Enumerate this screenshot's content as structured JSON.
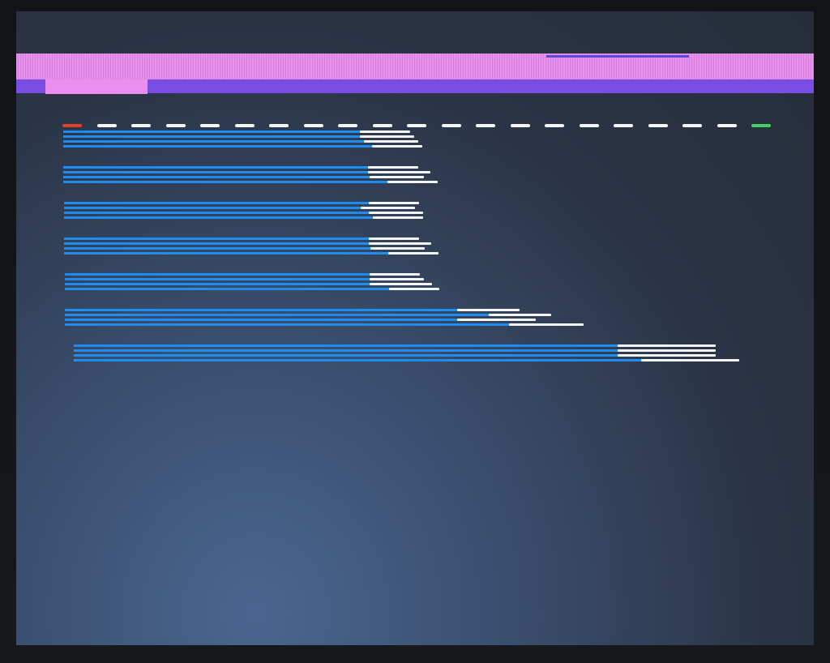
{
  "display": {
    "accent_color": "#e891ea",
    "secondary_color": "#7a4de4",
    "bar_color": "#1f8cf0",
    "tip_color": "#f3f5f7"
  },
  "dash_row": {
    "dash_count": 19,
    "left_marker_color": "#e0402a",
    "right_marker_color": "#3ed15b"
  },
  "groups": [
    {
      "lines": [
        {
          "blue": 0.38,
          "white": 0.055
        },
        {
          "blue": 0.38,
          "white": 0.06
        },
        {
          "blue": 0.385,
          "white": 0.06
        },
        {
          "blue": 0.395,
          "white": 0.055
        }
      ]
    },
    {
      "lines": [
        {
          "blue": 0.39,
          "white": 0.055
        },
        {
          "blue": 0.39,
          "white": 0.07
        },
        {
          "blue": 0.392,
          "white": 0.06
        },
        {
          "blue": 0.415,
          "white": 0.055
        }
      ]
    },
    {
      "lines": [
        {
          "blue": 0.39,
          "white": 0.055
        },
        {
          "blue": 0.38,
          "white": 0.06
        },
        {
          "blue": 0.39,
          "white": 0.06
        },
        {
          "blue": 0.395,
          "white": 0.055
        }
      ]
    },
    {
      "lines": [
        {
          "blue": 0.39,
          "white": 0.055
        },
        {
          "blue": 0.39,
          "white": 0.07
        },
        {
          "blue": 0.392,
          "white": 0.06
        },
        {
          "blue": 0.415,
          "white": 0.055
        }
      ]
    },
    {
      "lines": [
        {
          "blue": 0.39,
          "white": 0.055
        },
        {
          "blue": 0.39,
          "white": 0.06
        },
        {
          "blue": 0.39,
          "white": 0.07
        },
        {
          "blue": 0.415,
          "white": 0.055
        }
      ]
    },
    {
      "lines": [
        {
          "blue": 0.5,
          "white": 0.07
        },
        {
          "blue": 0.54,
          "white": 0.07
        },
        {
          "blue": 0.5,
          "white": 0.09
        },
        {
          "blue": 0.565,
          "white": 0.085
        }
      ]
    },
    {
      "lines": [
        {
          "blue": 0.69,
          "white": 0.115
        },
        {
          "blue": 0.69,
          "white": 0.115
        },
        {
          "blue": 0.69,
          "white": 0.115
        },
        {
          "blue": 0.72,
          "white": 0.115
        }
      ]
    }
  ]
}
